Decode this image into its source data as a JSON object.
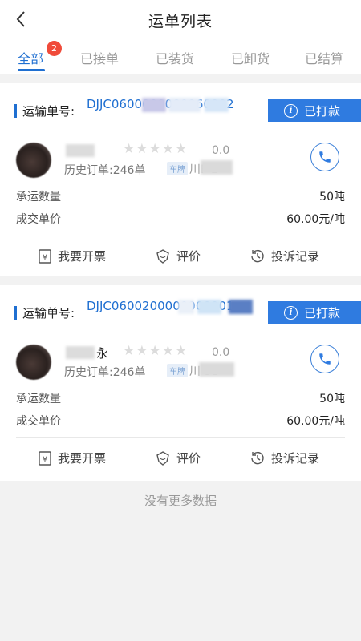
{
  "header": {
    "title": "运单列表",
    "back_icon": "chevron-left-icon"
  },
  "tabs": [
    {
      "label": "全部",
      "active": true,
      "badge": "2"
    },
    {
      "label": "已接单",
      "active": false
    },
    {
      "label": "已装货",
      "active": false
    },
    {
      "label": "已卸货",
      "active": false
    },
    {
      "label": "已结算",
      "active": false
    }
  ],
  "orders": [
    {
      "order_label": "运输单号:",
      "order_no": "DJJC0600000000060002",
      "status": "已打款",
      "driver_name": "",
      "rating": "0.0",
      "history": "历史订单:246单",
      "plate_tag": "车牌",
      "plate": "川F  1",
      "quantity_label": "承运数量",
      "quantity": "50吨",
      "price_label": "成交单价",
      "price": "60.00元/吨",
      "actions": {
        "invoice": "我要开票",
        "rate": "评价",
        "complaint": "投诉记录"
      }
    },
    {
      "order_label": "运输单号:",
      "order_no": "DJJC0600200000000001",
      "status": "已打款",
      "driver_name": "永",
      "rating": "0.0",
      "history": "历史订单:246单",
      "plate_tag": "车牌",
      "plate": "川  31",
      "quantity_label": "承运数量",
      "quantity": "50吨",
      "price_label": "成交单价",
      "price": "60.00元/吨",
      "actions": {
        "invoice": "我要开票",
        "rate": "评价",
        "complaint": "投诉记录"
      }
    }
  ],
  "footer": {
    "no_more": "没有更多数据"
  },
  "colors": {
    "accent": "#1f6fd1",
    "badge": "#f04b3a",
    "status_bg": "#2f7be0"
  }
}
